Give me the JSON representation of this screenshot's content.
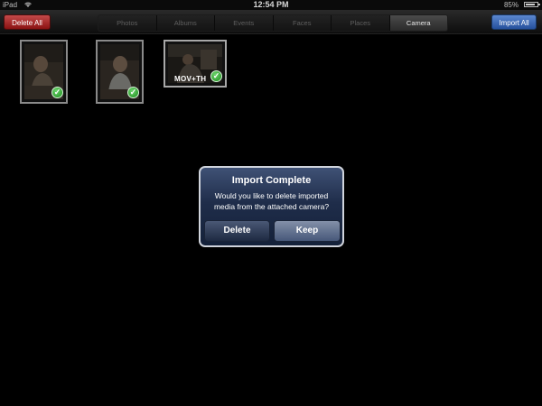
{
  "status_bar": {
    "device": "iPad",
    "wifi_icon": "wifi-icon",
    "time": "12:54 PM",
    "battery_text": "85%",
    "battery_level": 0.85
  },
  "toolbar": {
    "delete_all_label": "Delete All",
    "import_all_label": "Import All",
    "tabs": [
      {
        "label": "Photos",
        "active": false
      },
      {
        "label": "Albums",
        "active": false
      },
      {
        "label": "Events",
        "active": false
      },
      {
        "label": "Faces",
        "active": false
      },
      {
        "label": "Places",
        "active": false
      },
      {
        "label": "Camera",
        "active": true
      }
    ],
    "colors": {
      "delete": "#a32a2a",
      "import": "#3a69b8"
    }
  },
  "media": {
    "items": [
      {
        "kind": "photo",
        "selected": true
      },
      {
        "kind": "photo",
        "selected": true
      },
      {
        "kind": "video",
        "label": "MOV+TH",
        "selected": true
      }
    ],
    "check_icon": "checkmark-icon"
  },
  "alert": {
    "title": "Import Complete",
    "message": "Would you like to delete imported media from the attached camera?",
    "delete_label": "Delete",
    "keep_label": "Keep"
  }
}
